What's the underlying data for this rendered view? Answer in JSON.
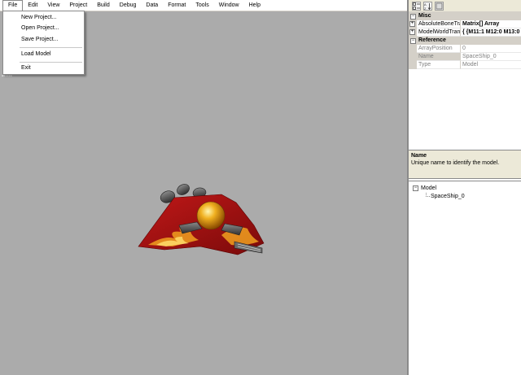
{
  "menubar": {
    "items": [
      "File",
      "Edit",
      "View",
      "Project",
      "Build",
      "Debug",
      "Data",
      "Format",
      "Tools",
      "Window",
      "Help"
    ]
  },
  "file_menu": {
    "items": [
      "New Project...",
      "Open Project...",
      "Save Project...",
      "Load Model",
      "Exit"
    ]
  },
  "viewport": {
    "background": "#ababab"
  },
  "property_grid": {
    "categories": [
      {
        "name": "Misc",
        "rows": [
          {
            "name": "AbsoluteBoneTra",
            "value": "Matrix[] Array"
          },
          {
            "name": "ModelWorldTranc",
            "value": "{ {M11:1 M12:0 M13:0"
          }
        ]
      },
      {
        "name": "Reference",
        "rows": [
          {
            "name": "ArrayPosition",
            "value": "0"
          },
          {
            "name": "Name",
            "value": "SpaceShip_0"
          },
          {
            "name": "Type",
            "value": "Model"
          }
        ]
      }
    ],
    "description": {
      "title": "Name",
      "text": "Unique name to identify the model."
    }
  },
  "tree": {
    "root": "Model",
    "children": [
      "SpaceShip_0"
    ]
  }
}
